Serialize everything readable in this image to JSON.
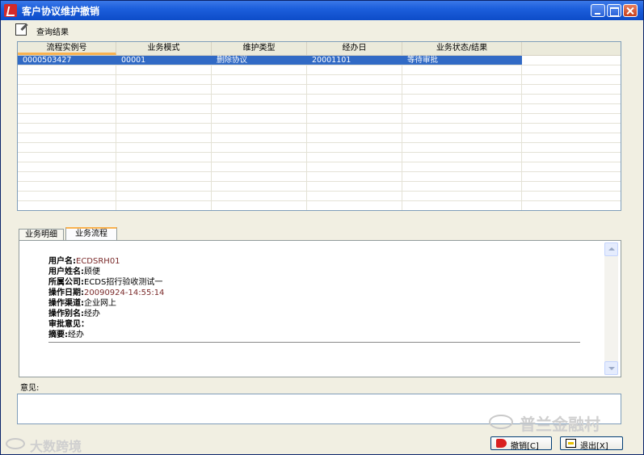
{
  "window": {
    "title": "客户协议维护撤销"
  },
  "toolbar": {
    "query_label": "查询结果"
  },
  "grid": {
    "headers": [
      "流程实例号",
      "业务模式",
      "维护类型",
      "经办日",
      "业务状态/结果",
      ""
    ],
    "rows": [
      [
        "0000503427",
        "00001",
        "删除协议",
        "20001101",
        "等待审批"
      ]
    ]
  },
  "tabs": [
    "业务明细",
    "业务流程"
  ],
  "detail": {
    "fields": [
      {
        "label": "用户名:",
        "value": "ECDSRH01"
      },
      {
        "label": "用户姓名:",
        "value": "顾便"
      },
      {
        "label": "所属公司:",
        "value": "ECDS招行验收测试一"
      },
      {
        "label": "操作日期:",
        "value": "20090924-14:55:14"
      },
      {
        "label": "操作渠道:",
        "value": "企业网上"
      },
      {
        "label": "操作别名:",
        "value": "经办"
      },
      {
        "label": "审批意见：",
        "value": ""
      },
      {
        "label": "摘要:",
        "value": "经办"
      }
    ]
  },
  "opinion": {
    "label": "意见:",
    "value": ""
  },
  "buttons": {
    "revoke": "撤销[C]",
    "exit": "退出[X]"
  },
  "watermarks": {
    "right": "普兰金融村",
    "left": "大数跨境"
  }
}
